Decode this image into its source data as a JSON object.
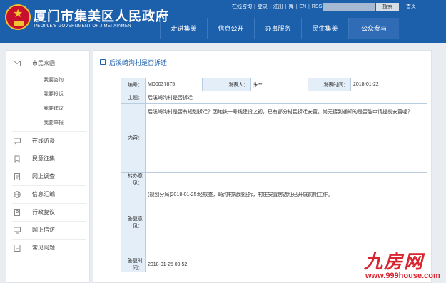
{
  "header": {
    "title": "厦门市集美区人民政府",
    "subtitle": "PEOPLE'S GOVERNMENT OF JIMEI XIAMEN",
    "toplinks": [
      "在线咨询",
      "登录",
      "注册",
      "舞",
      "EN",
      "RSS"
    ],
    "search_button": "搜索",
    "home_link": "首页",
    "nav": [
      "走进集美",
      "信息公开",
      "办事服务",
      "民生集美",
      "公众参与"
    ],
    "active_nav": "公众参与",
    "brand_color": "#1c5fab"
  },
  "sidebar": {
    "sections": [
      {
        "label": "市民来函",
        "icon": "mail-icon",
        "items": [
          "我要咨询",
          "我要投诉",
          "我要建议",
          "我要举报"
        ]
      },
      {
        "label": "在线访谈",
        "icon": "chat-icon"
      },
      {
        "label": "民意征集",
        "icon": "collection-icon"
      },
      {
        "label": "网上调查",
        "icon": "survey-icon"
      },
      {
        "label": "信息汇编",
        "icon": "globe-icon"
      },
      {
        "label": "行政复议",
        "icon": "gavel-icon"
      },
      {
        "label": "网上信访",
        "icon": "monitor-icon"
      },
      {
        "label": "常见问题",
        "icon": "question-icon"
      }
    ]
  },
  "main": {
    "page_title": "后溪崎沟村是否拆迁",
    "table": {
      "id_label": "编号：",
      "id_value": "MD0037875",
      "poster_label": "发表人：",
      "poster_value": "朱**",
      "time_label": "发表时间：",
      "time_value": "2018-01-22",
      "subject_label": "主题：",
      "subject_value": "后溪崎沟村是否拆迁",
      "content_label": "内容：",
      "content_value": "后溪崎沟村是否有规划拆迁？因地铁一号线建设之初，已有部分村民拆迁安置，尚无接到通知的是否能申请提前安置呢？",
      "transfer_label": "转办意见：",
      "transfer_value": "",
      "reply_label": "答复意见：",
      "reply_value": "(规划分局)2018-01-25:经核查，崎沟村规划征拆，村庄安置房选址已开展前期工作。",
      "reply_time_label": "答复时间：",
      "reply_time_value": "2018-01-25 09:52"
    }
  },
  "watermark": {
    "text": "九房网",
    "url": "www.999house.com"
  }
}
